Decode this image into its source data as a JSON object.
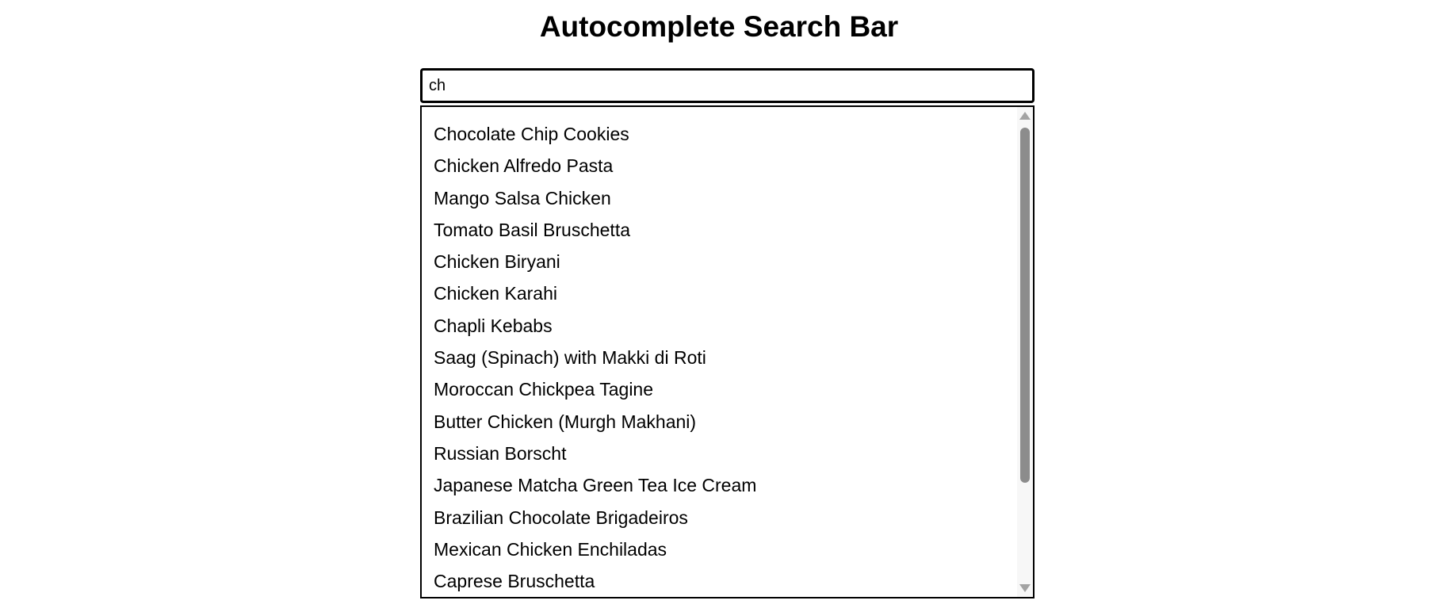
{
  "header": {
    "title": "Autocomplete Search Bar"
  },
  "search": {
    "value": "ch",
    "placeholder": ""
  },
  "suggestions": [
    "Chocolate Chip Cookies",
    "Chicken Alfredo Pasta",
    "Mango Salsa Chicken",
    "Tomato Basil Bruschetta",
    "Chicken Biryani",
    "Chicken Karahi",
    "Chapli Kebabs",
    "Saag (Spinach) with Makki di Roti",
    "Moroccan Chickpea Tagine",
    "Butter Chicken (Murgh Makhani)",
    "Russian Borscht",
    "Japanese Matcha Green Tea Ice Cream",
    "Brazilian Chocolate Brigadeiros",
    "Mexican Chicken Enchiladas",
    "Caprese Bruschetta"
  ],
  "colors": {
    "border": "#000000",
    "scrollbar_track": "#f7f7f7",
    "scrollbar_thumb": "#8c8c8c",
    "scrollbar_arrow": "#a3a3a3"
  }
}
